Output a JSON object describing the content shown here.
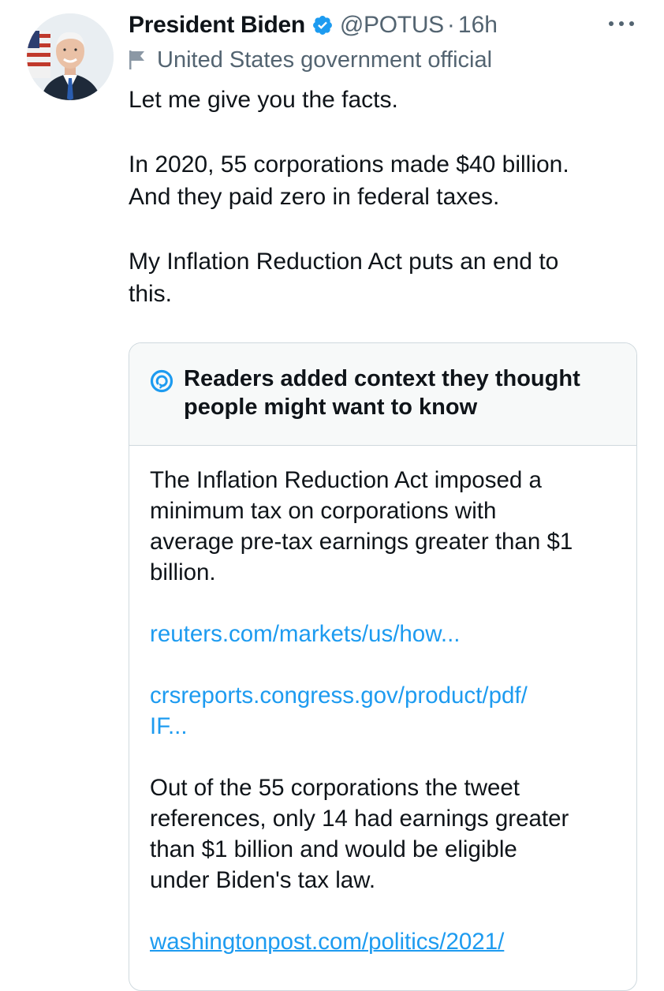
{
  "tweet": {
    "display_name": "President Biden",
    "handle": "@POTUS",
    "separator": "·",
    "time": "16h",
    "label": "United States government official",
    "text": {
      "line1": "Let me give you the facts.",
      "line2": "In 2020, 55 corporations made $40 billion.",
      "line3": "And they paid zero in federal taxes.",
      "line4": "My Inflation Reduction Act puts an end to",
      "line5": "this."
    }
  },
  "community_note": {
    "title_line1": "Readers added context they thought",
    "title_line2": "people might want to know",
    "paragraph1": {
      "line1": "The Inflation Reduction Act imposed a",
      "line2": "minimum tax on corporations with",
      "line3": "average pre-tax earnings greater than $1",
      "line4": "billion."
    },
    "link1": "reuters.com/markets/us/how...",
    "link2": {
      "line1": "crsreports.congress.gov/product/pdf/",
      "line2": "IF..."
    },
    "paragraph2": {
      "line1": "Out of the 55 corporations the tweet",
      "line2": "references, only 14 had earnings greater",
      "line3": "than $1 billion and would be eligible",
      "line4": "under Biden's tax law."
    },
    "link3": "washingtonpost.com/politics/2021/"
  },
  "colors": {
    "text": "#0f1419",
    "secondary": "#536471",
    "link": "#1d9bf0",
    "note_header_bg": "#f7f9f9",
    "border": "#cfd9de",
    "verified": "#1d9bf0"
  },
  "icons": {
    "verified": "verified-badge-icon",
    "more": "more-options-icon",
    "label": "flag-icon",
    "note": "community-notes-icon"
  }
}
